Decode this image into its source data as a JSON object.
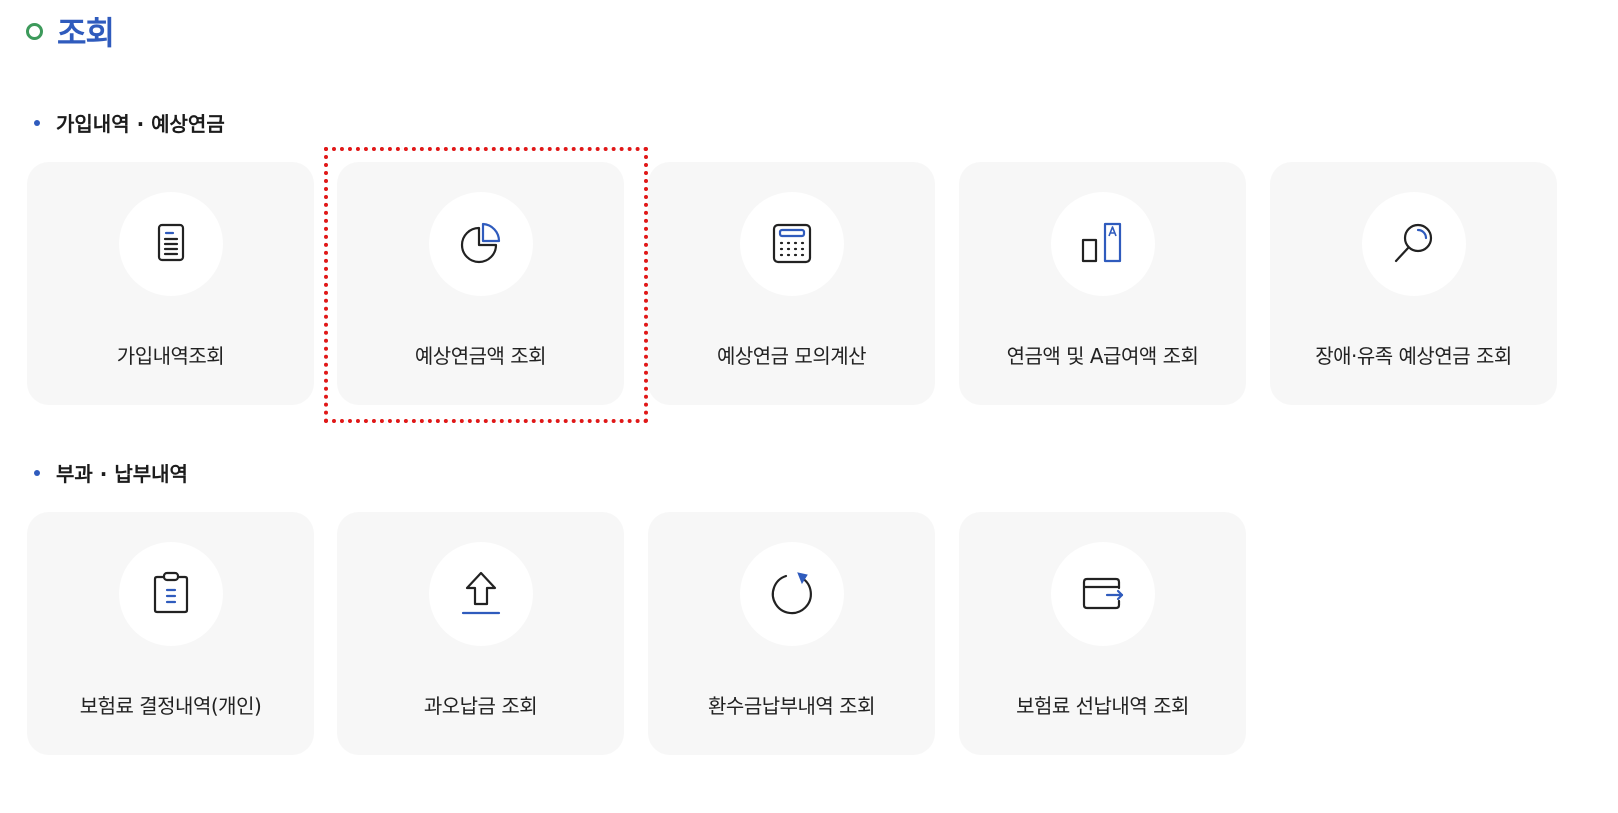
{
  "page": {
    "title": "조회"
  },
  "sections": [
    {
      "heading": "가입내역 · 예상연금",
      "cards": [
        {
          "label": "가입내역조회",
          "icon": "document-icon"
        },
        {
          "label": "예상연금액 조회",
          "icon": "pie-chart-icon"
        },
        {
          "label": "예상연금 모의계산",
          "icon": "calculator-icon"
        },
        {
          "label": "연금액 및 A급여액 조회",
          "icon": "bar-a-icon"
        },
        {
          "label": "장애·유족 예상연금 조회",
          "icon": "magnifier-icon"
        }
      ]
    },
    {
      "heading": "부과 · 납부내역",
      "cards": [
        {
          "label": "보험료 결정내역(개인)",
          "icon": "clipboard-icon"
        },
        {
          "label": "과오납금 조회",
          "icon": "upload-arrow-icon"
        },
        {
          "label": "환수금납부내역 조회",
          "icon": "refresh-icon"
        },
        {
          "label": "보험료 선납내역 조회",
          "icon": "card-arrow-icon"
        }
      ]
    }
  ],
  "colors": {
    "title": "#2f5bbd",
    "accent_blue": "#2f5bbd",
    "title_ring": "#3d9a5b",
    "card_bg": "#f7f7f7",
    "highlight": "#e01818"
  }
}
